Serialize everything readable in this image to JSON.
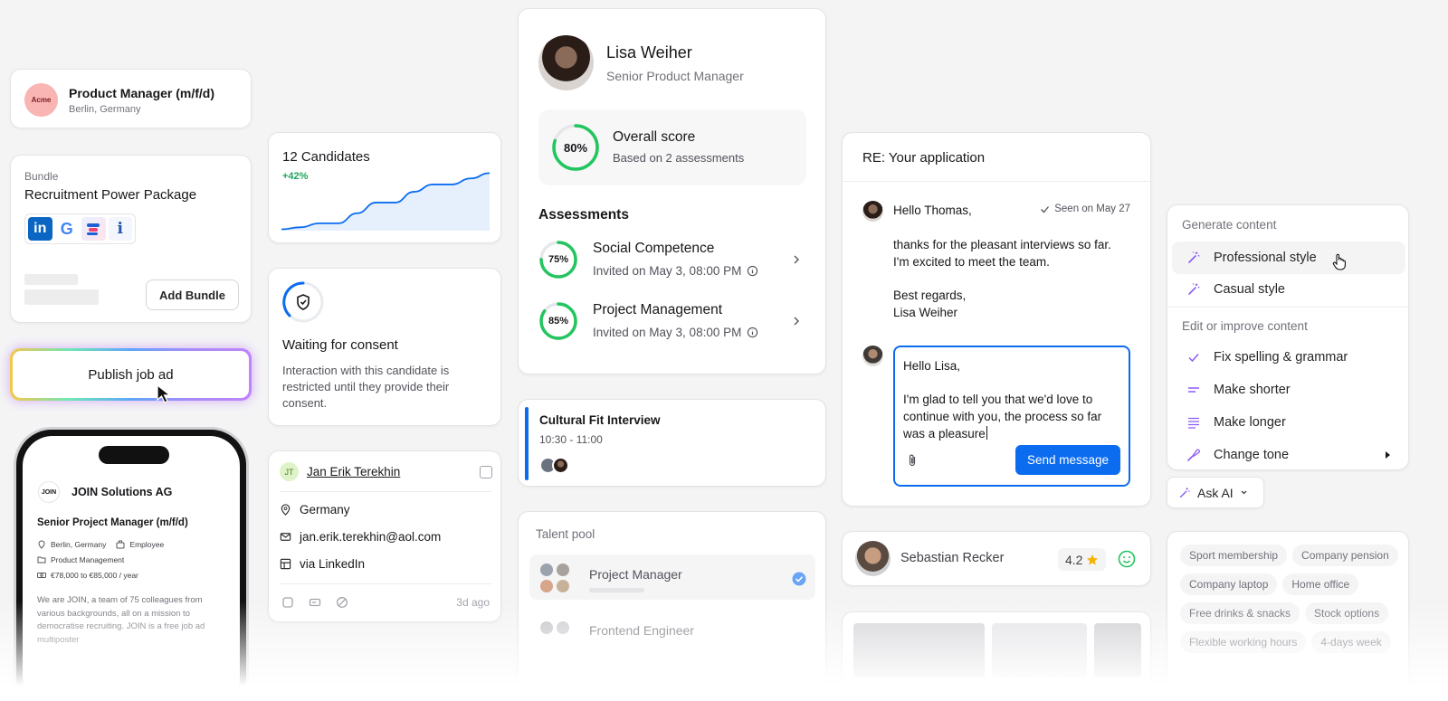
{
  "colors": {
    "accent": "#0b6cf0",
    "success": "#22c55e",
    "purple": "#8b5cf6",
    "star": "#f5b301"
  },
  "job_card": {
    "logo_text": "Acme",
    "title": "Product Manager (m/f/d)",
    "location": "Berlin, Germany"
  },
  "bundle": {
    "label": "Bundle",
    "title": "Recruitment Power Package",
    "logos": [
      "linkedin-logo",
      "google-logo",
      "stepstone-logo",
      "indeed-logo"
    ],
    "add_label": "Add Bundle"
  },
  "publish": {
    "label": "Publish job ad"
  },
  "phone": {
    "logo_text": "JOIN",
    "company": "JOIN Solutions AG",
    "job_title": "Senior Project Manager (m/f/d)",
    "location": "Berlin, Germany",
    "employment": "Employee",
    "department": "Product Management",
    "salary": "€78,000 to €85,000 / year",
    "description": "We are JOIN, a team of 75 colleagues from various backgrounds, all on a mission to democratise recruiting. JOIN is a free job ad multiposter"
  },
  "candidates": {
    "title": "12 Candidates",
    "growth": "+42%",
    "trend": [
      2,
      5,
      11,
      11,
      26,
      42,
      42,
      58,
      69,
      69,
      78,
      86
    ]
  },
  "consent": {
    "title": "Waiting for consent",
    "text": "Interaction with this candidate is restricted until they provide their consent."
  },
  "contact": {
    "initials": "JT",
    "name": "Jan Erik Terekhin",
    "country": "Germany",
    "email": "jan.erik.terekhin@aol.com",
    "source": "via LinkedIn",
    "time": "3d ago"
  },
  "profile": {
    "name": "Lisa Weiher",
    "role": "Senior Product Manager",
    "overall_score": 80,
    "overall_label": "80%",
    "overall_title": "Overall score",
    "overall_sub": "Based on 2 assessments",
    "assessments_title": "Assessments",
    "assessments": [
      {
        "name": "Social Competence",
        "score": 75,
        "label": "75%",
        "date": "Invited on May 3, 08:00 PM"
      },
      {
        "name": "Project Management",
        "score": 85,
        "label": "85%",
        "date": "Invited on May 3, 08:00 PM"
      }
    ]
  },
  "interview": {
    "title": "Cultural Fit Interview",
    "time": "10:30 - 11:00"
  },
  "talent_pool": {
    "title": "Talent pool",
    "items": [
      {
        "name": "Project Manager"
      },
      {
        "name": "Frontend Engineer"
      }
    ]
  },
  "email": {
    "subject": "RE: Your application",
    "greeting": "Hello Thomas,",
    "seen": "Seen on May 27",
    "body_1": "thanks for the pleasant interviews so far.",
    "body_2": "I'm excited to meet the team.",
    "sign_1": "Best regards,",
    "sign_2": "Lisa Weiher",
    "reply_1": "Hello Lisa,",
    "reply_2": "I'm glad to tell you that we'd love to continue with you, the process so far was a pleasure",
    "send_label": "Send message"
  },
  "ai_menu": {
    "section_1": "Generate content",
    "generate": [
      {
        "label": "Professional style",
        "icon": "magic-wand-icon"
      },
      {
        "label": "Casual style",
        "icon": "magic-wand-icon"
      }
    ],
    "section_2": "Edit or improve content",
    "edit": [
      {
        "label": "Fix spelling & grammar",
        "icon": "check-icon"
      },
      {
        "label": "Make shorter",
        "icon": "short-lines-icon"
      },
      {
        "label": "Make longer",
        "icon": "long-lines-icon"
      },
      {
        "label": "Change tone",
        "icon": "brush-icon"
      }
    ],
    "ask_label": "Ask AI"
  },
  "rating": {
    "name": "Sebastian Recker",
    "score": "4.2"
  },
  "benefits": {
    "items": [
      "Sport membership",
      "Company pension",
      "Company laptop",
      "Home office",
      "Free drinks & snacks",
      "Stock options",
      "Flexible working hours",
      "4-days week"
    ]
  }
}
